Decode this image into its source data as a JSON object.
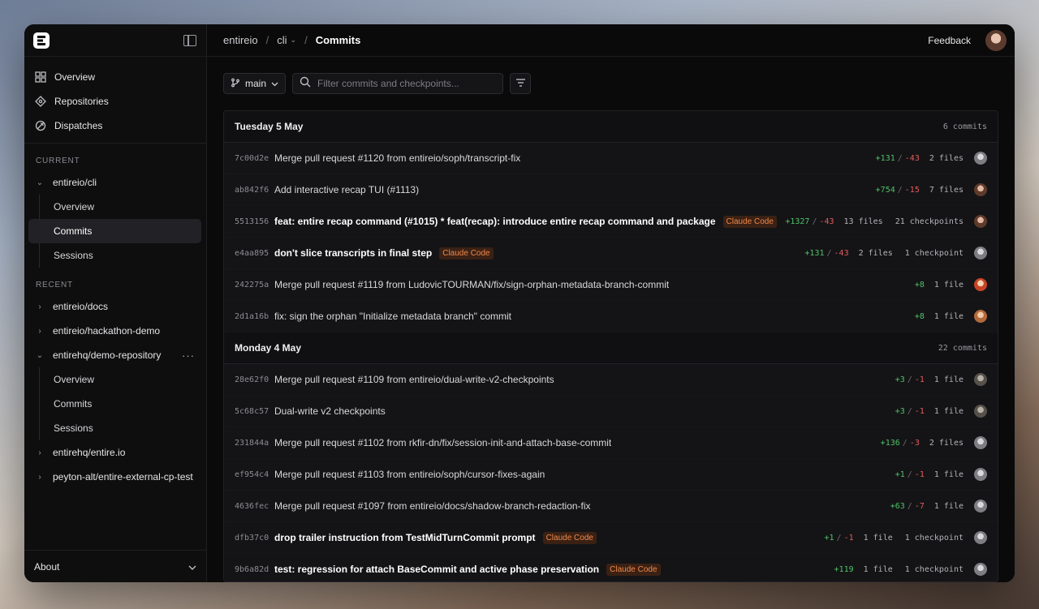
{
  "sidebar": {
    "nav": [
      {
        "label": "Overview",
        "icon": "grid-icon"
      },
      {
        "label": "Repositories",
        "icon": "repo-diamond-icon"
      },
      {
        "label": "Dispatches",
        "icon": "satellite-icon"
      }
    ],
    "current_label": "CURRENT",
    "current_repo": "entireio/cli",
    "current_sub": [
      "Overview",
      "Commits",
      "Sessions"
    ],
    "recent_label": "RECENT",
    "recent": [
      {
        "label": "entireio/docs"
      },
      {
        "label": "entireio/hackathon-demo"
      },
      {
        "label": "entirehq/demo-repository",
        "menu": "···"
      },
      {
        "label": "entirehq/entire.io"
      },
      {
        "label": "peyton-alt/entire-external-cp-test"
      }
    ],
    "recent_sub": [
      "Overview",
      "Commits",
      "Sessions"
    ],
    "about": "About"
  },
  "header": {
    "breadcrumb": [
      "entireio",
      "cli",
      "Commits"
    ],
    "separator": "/",
    "feedback": "Feedback"
  },
  "toolbar": {
    "branch": "main",
    "search_placeholder": "Filter commits and checkpoints..."
  },
  "groups": [
    {
      "date": "Tuesday 5 May",
      "count": "6 commits",
      "commits": [
        {
          "hash": "7c00d2e",
          "message": "Merge pull request #1120 from entireio/soph/transcript-fix",
          "bold": false,
          "badge": "",
          "add": "+131",
          "del": "-43",
          "files": "2 files",
          "checkpoints": "",
          "avatar": "grey"
        },
        {
          "hash": "ab842f6",
          "message": "Add interactive recap TUI (#1113)",
          "bold": false,
          "badge": "",
          "add": "+754",
          "del": "-15",
          "files": "7 files",
          "checkpoints": "",
          "avatar": "brown"
        },
        {
          "hash": "5513156",
          "message": "feat: entire recap command (#1015) * feat(recap): introduce entire recap command and package",
          "bold": true,
          "badge": "Claude Code",
          "add": "+1327",
          "del": "-43",
          "files": "13 files",
          "checkpoints": "21 checkpoints",
          "avatar": "brown"
        },
        {
          "hash": "e4aa895",
          "message": "don't slice transcripts in final step",
          "bold": true,
          "badge": "Claude Code",
          "add": "+131",
          "del": "-43",
          "files": "2 files",
          "checkpoints": "1 checkpoint",
          "avatar": "grey"
        },
        {
          "hash": "242275a",
          "message": "Merge pull request #1119 from LudovicTOURMAN/fix/sign-orphan-metadata-branch-commit",
          "bold": false,
          "badge": "",
          "add": "+8",
          "del": "",
          "files": "1 file",
          "checkpoints": "",
          "avatar": "red"
        },
        {
          "hash": "2d1a16b",
          "message": "fix: sign the orphan \"Initialize metadata branch\" commit",
          "bold": false,
          "badge": "",
          "add": "+8",
          "del": "",
          "files": "1 file",
          "checkpoints": "",
          "avatar": "orange"
        }
      ]
    },
    {
      "date": "Monday 4 May",
      "count": "22 commits",
      "commits": [
        {
          "hash": "28e62f0",
          "message": "Merge pull request #1109 from entireio/dual-write-v2-checkpoints",
          "bold": false,
          "badge": "",
          "add": "+3",
          "del": "-1",
          "files": "1 file",
          "checkpoints": "",
          "avatar": "dark"
        },
        {
          "hash": "5c68c57",
          "message": "Dual-write v2 checkpoints",
          "bold": false,
          "badge": "",
          "add": "+3",
          "del": "-1",
          "files": "1 file",
          "checkpoints": "",
          "avatar": "dark"
        },
        {
          "hash": "231844a",
          "message": "Merge pull request #1102 from rkfir-dn/fix/session-init-and-attach-base-commit",
          "bold": false,
          "badge": "",
          "add": "+136",
          "del": "-3",
          "files": "2 files",
          "checkpoints": "",
          "avatar": "grey"
        },
        {
          "hash": "ef954c4",
          "message": "Merge pull request #1103 from entireio/soph/cursor-fixes-again",
          "bold": false,
          "badge": "",
          "add": "+1",
          "del": "-1",
          "files": "1 file",
          "checkpoints": "",
          "avatar": "grey"
        },
        {
          "hash": "4636fec",
          "message": "Merge pull request #1097 from entireio/docs/shadow-branch-redaction-fix",
          "bold": false,
          "badge": "",
          "add": "+63",
          "del": "-7",
          "files": "1 file",
          "checkpoints": "",
          "avatar": "grey"
        },
        {
          "hash": "dfb37c0",
          "message": "drop trailer instruction from TestMidTurnCommit prompt",
          "bold": true,
          "badge": "Claude Code",
          "add": "+1",
          "del": "-1",
          "files": "1 file",
          "checkpoints": "1 checkpoint",
          "avatar": "grey"
        },
        {
          "hash": "9b6a82d",
          "message": "test: regression for attach BaseCommit and active phase preservation",
          "bold": true,
          "badge": "Claude Code",
          "add": "+119",
          "del": "",
          "files": "1 file",
          "checkpoints": "1 checkpoint",
          "avatar": "grey"
        }
      ]
    }
  ]
}
